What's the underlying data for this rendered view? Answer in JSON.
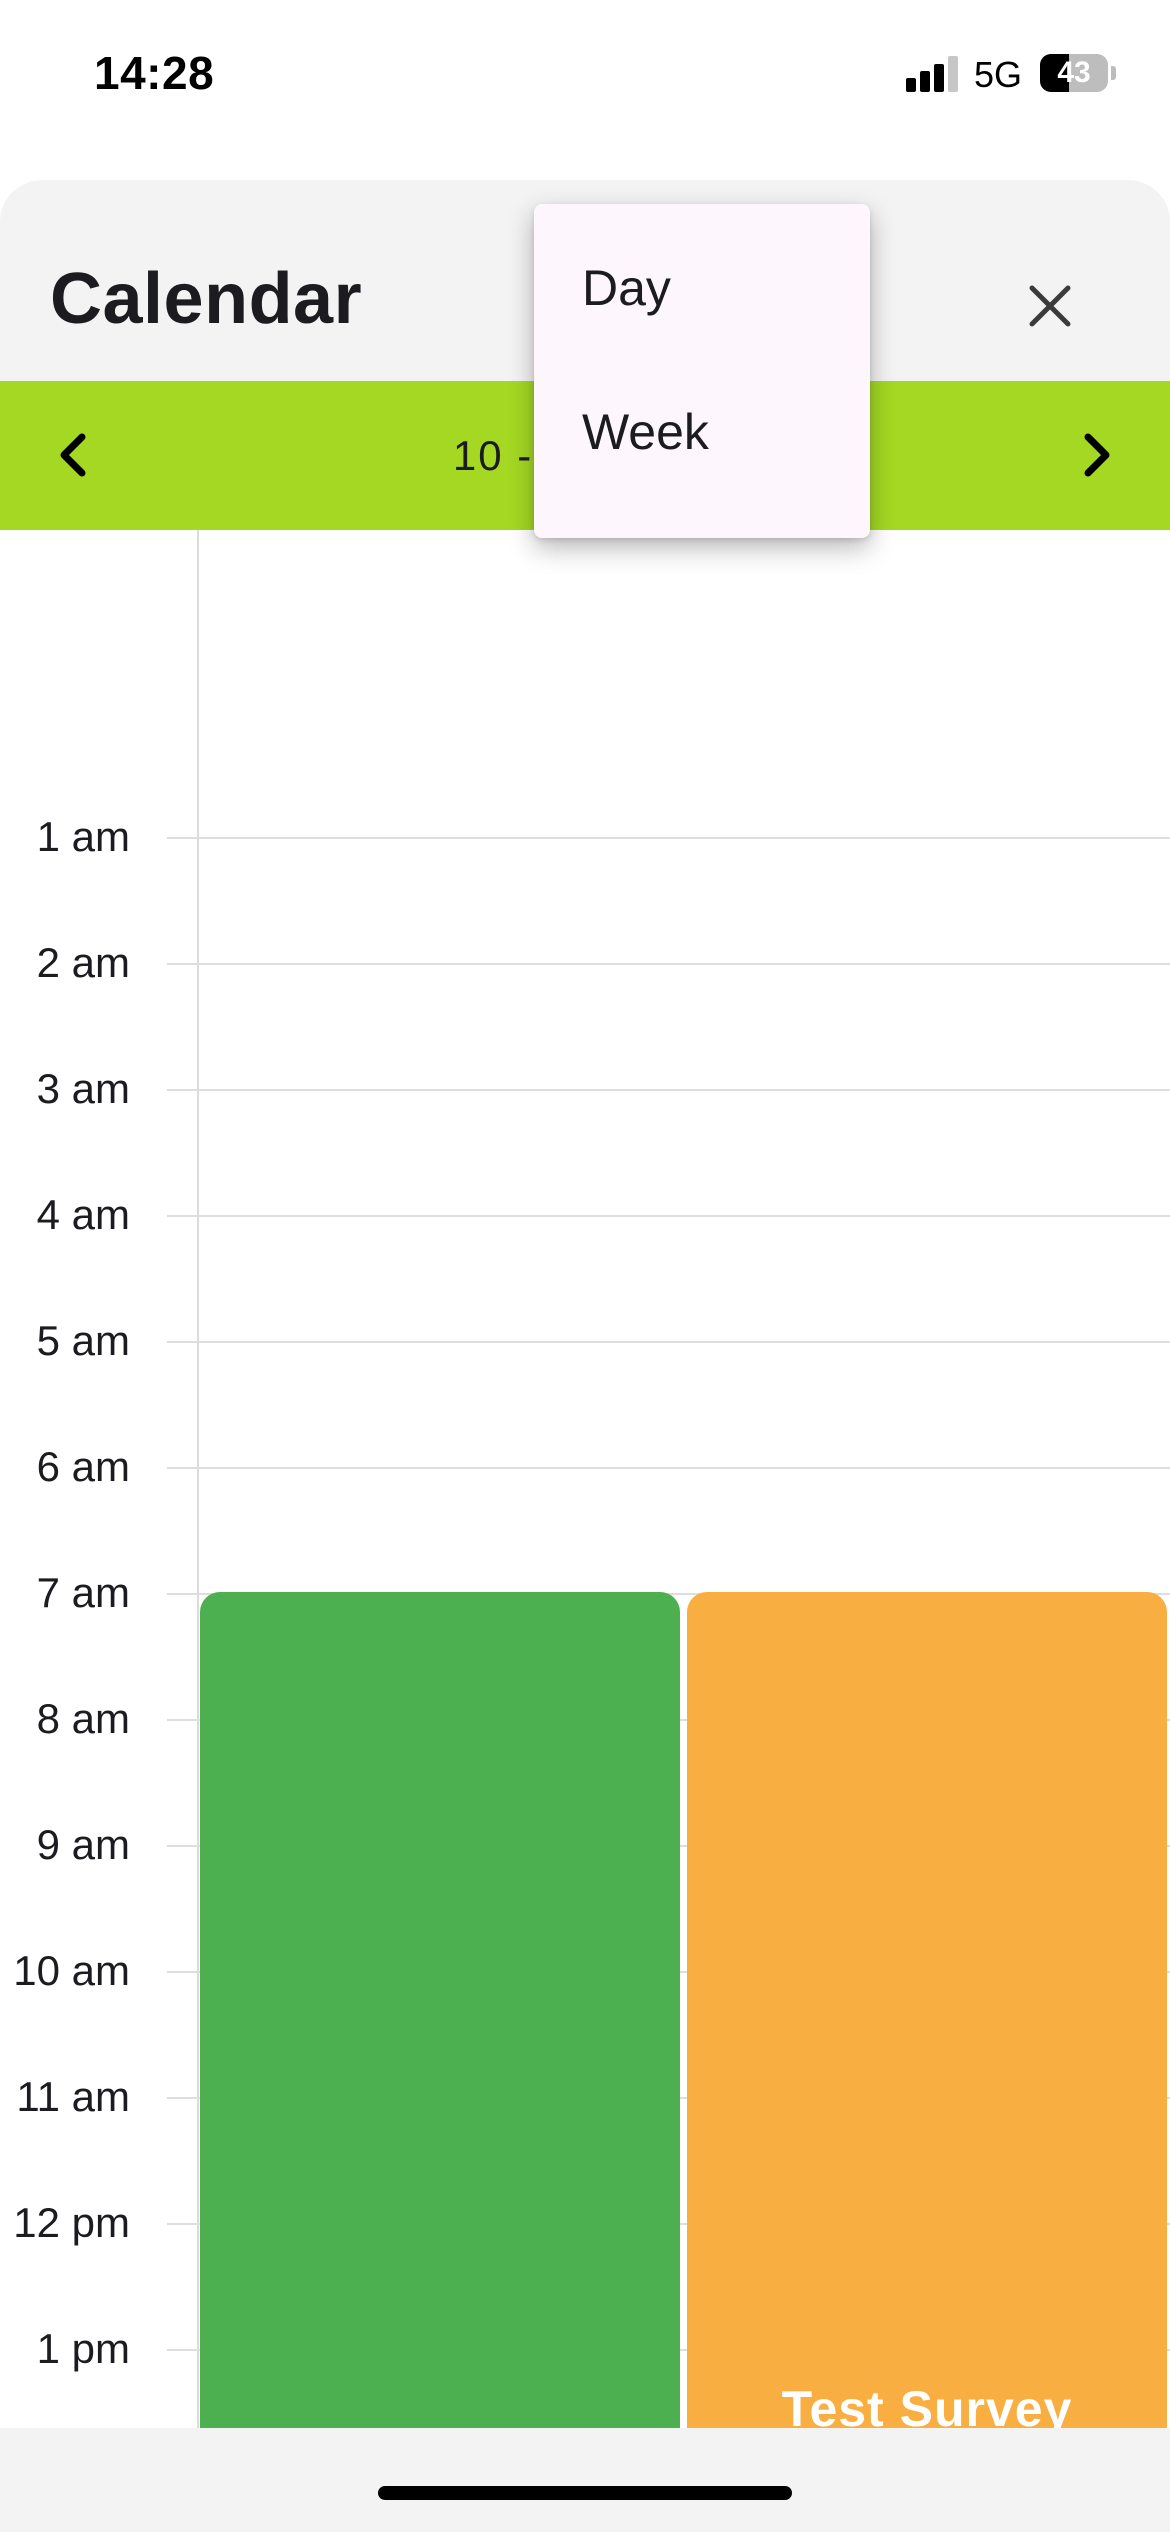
{
  "status_bar": {
    "time": "14:28",
    "network": "5G",
    "battery": "43",
    "battery_level": 0.43,
    "signal_bars": 3
  },
  "sheet": {
    "title": "Calendar",
    "close_icon": "close-icon"
  },
  "view_menu": {
    "items": [
      "Day",
      "Week"
    ]
  },
  "date_nav": {
    "date": "10 - 1 - 2025",
    "prev_icon": "chevron-left-icon",
    "next_icon": "chevron-right-icon"
  },
  "hours": [
    "1 am",
    "2 am",
    "3 am",
    "4 am",
    "5 am",
    "6 am",
    "7 am",
    "8 am",
    "9 am",
    "10 am",
    "11 am",
    "12 pm",
    "1 pm"
  ],
  "events": [
    {
      "title": "",
      "color": "#4caf50",
      "start": "7 am"
    },
    {
      "title": "Test Survey",
      "color": "#f9ae42",
      "start": "7 am"
    }
  ],
  "colors": {
    "accent": "#a4d823",
    "sheet_bg": "#f3f3f3",
    "menu_bg": "#fdf7fd"
  }
}
